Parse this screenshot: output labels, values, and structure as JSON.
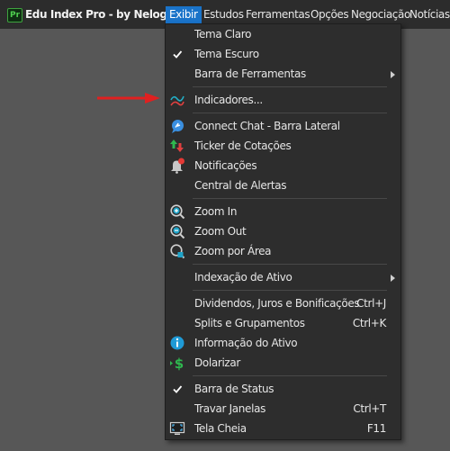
{
  "app": {
    "icon_text": "Pr",
    "title": "Edu Index Pro - by Nelogica"
  },
  "menubar": {
    "items": [
      {
        "label": "Exibir"
      },
      {
        "label": "Estudos"
      },
      {
        "label": "Ferramentas"
      },
      {
        "label": "Opções"
      },
      {
        "label": "Negociação"
      },
      {
        "label": "Notícias"
      }
    ]
  },
  "exibir_menu": {
    "items": [
      {
        "label": "Tema Claro"
      },
      {
        "label": "Tema Escuro",
        "checked": true
      },
      {
        "label": "Barra de Ferramentas",
        "submenu": true
      },
      {
        "label": "Indicadores...",
        "icon": "indicators-icon"
      },
      {
        "label": "Connect Chat - Barra Lateral",
        "icon": "chat-icon"
      },
      {
        "label": "Ticker de Cotações",
        "icon": "ticker-arrows-icon"
      },
      {
        "label": "Notificações",
        "icon": "bell-icon"
      },
      {
        "label": "Central de Alertas"
      },
      {
        "label": "Zoom In",
        "icon": "zoom-in-icon"
      },
      {
        "label": "Zoom Out",
        "icon": "zoom-out-icon"
      },
      {
        "label": "Zoom por Área",
        "icon": "zoom-area-icon"
      },
      {
        "label": "Indexação de Ativo",
        "submenu": true
      },
      {
        "label": "Dividendos, Juros e Bonificações",
        "shortcut": "Ctrl+J"
      },
      {
        "label": "Splits e Grupamentos",
        "shortcut": "Ctrl+K"
      },
      {
        "label": "Informação do Ativo",
        "icon": "info-icon"
      },
      {
        "label": "Dolarizar",
        "icon": "dollar-icon"
      },
      {
        "label": "Barra de Status",
        "checked": true
      },
      {
        "label": "Travar Janelas",
        "shortcut": "Ctrl+T"
      },
      {
        "label": "Tela Cheia",
        "shortcut": "F11",
        "icon": "fullscreen-icon"
      }
    ]
  },
  "colors": {
    "active_menu": "#1a73c9",
    "annotation_arrow": "#e02020"
  }
}
